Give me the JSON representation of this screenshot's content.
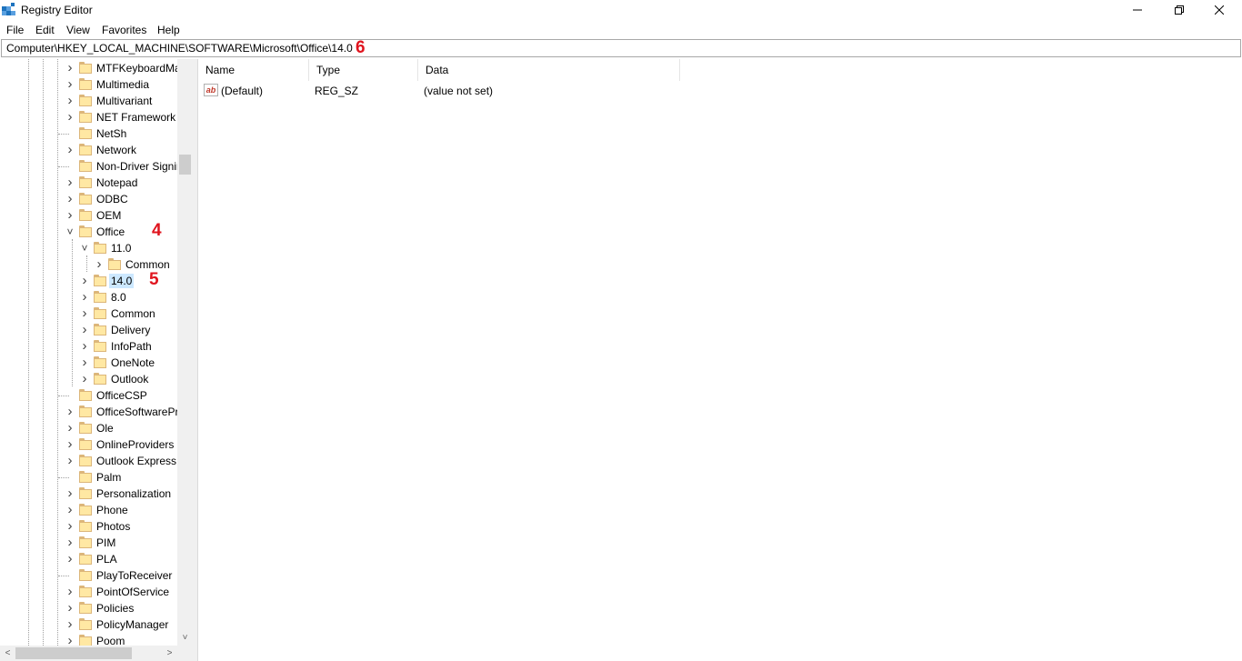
{
  "window": {
    "title": "Registry Editor",
    "minimize": "—",
    "maximize": "❐",
    "close": "✕"
  },
  "menu": [
    "File",
    "Edit",
    "View",
    "Favorites",
    "Help"
  ],
  "address": {
    "path": "Computer\\HKEY_LOCAL_MACHINE\\SOFTWARE\\Microsoft\\Office\\14.0"
  },
  "annotations": {
    "four": "4",
    "five": "5",
    "six": "6"
  },
  "tree": {
    "items": [
      {
        "label": "MTFKeyboardMappings",
        "expander": "collapsed"
      },
      {
        "label": "Multimedia",
        "expander": "collapsed"
      },
      {
        "label": "Multivariant",
        "expander": "collapsed"
      },
      {
        "label": "NET Framework Setup",
        "expander": "collapsed"
      },
      {
        "label": "NetSh",
        "expander": "none"
      },
      {
        "label": "Network",
        "expander": "collapsed"
      },
      {
        "label": "Non-Driver Signing",
        "expander": "none"
      },
      {
        "label": "Notepad",
        "expander": "collapsed"
      },
      {
        "label": "ODBC",
        "expander": "collapsed"
      },
      {
        "label": "OEM",
        "expander": "collapsed"
      },
      {
        "label": "Office",
        "expander": "expanded"
      },
      {
        "label": "11.0",
        "expander": "expanded"
      },
      {
        "label": "Common",
        "expander": "collapsed"
      },
      {
        "label": "14.0",
        "expander": "collapsed",
        "selected": true
      },
      {
        "label": "8.0",
        "expander": "collapsed"
      },
      {
        "label": "Common",
        "expander": "collapsed"
      },
      {
        "label": "Delivery",
        "expander": "collapsed"
      },
      {
        "label": "InfoPath",
        "expander": "collapsed"
      },
      {
        "label": "OneNote",
        "expander": "collapsed"
      },
      {
        "label": "Outlook",
        "expander": "collapsed"
      },
      {
        "label": "OfficeCSP",
        "expander": "none"
      },
      {
        "label": "OfficeSoftwareProtectionPlatform",
        "expander": "collapsed"
      },
      {
        "label": "Ole",
        "expander": "collapsed"
      },
      {
        "label": "OnlineProviders",
        "expander": "collapsed"
      },
      {
        "label": "Outlook Express",
        "expander": "collapsed"
      },
      {
        "label": "Palm",
        "expander": "none"
      },
      {
        "label": "Personalization",
        "expander": "collapsed"
      },
      {
        "label": "Phone",
        "expander": "collapsed"
      },
      {
        "label": "Photos",
        "expander": "collapsed"
      },
      {
        "label": "PIM",
        "expander": "collapsed"
      },
      {
        "label": "PLA",
        "expander": "collapsed"
      },
      {
        "label": "PlayToReceiver",
        "expander": "none"
      },
      {
        "label": "PointOfService",
        "expander": "collapsed"
      },
      {
        "label": "Policies",
        "expander": "collapsed"
      },
      {
        "label": "PolicyManager",
        "expander": "collapsed"
      },
      {
        "label": "Poom",
        "expander": "collapsed"
      }
    ]
  },
  "list": {
    "columns": [
      "Name",
      "Type",
      "Data"
    ],
    "rows": [
      {
        "name": "(Default)",
        "type": "REG_SZ",
        "data": "(value not set)",
        "icon": "ab"
      }
    ]
  },
  "scrollbar": {
    "up_down": "˅",
    "left": "<",
    "right": ">"
  }
}
